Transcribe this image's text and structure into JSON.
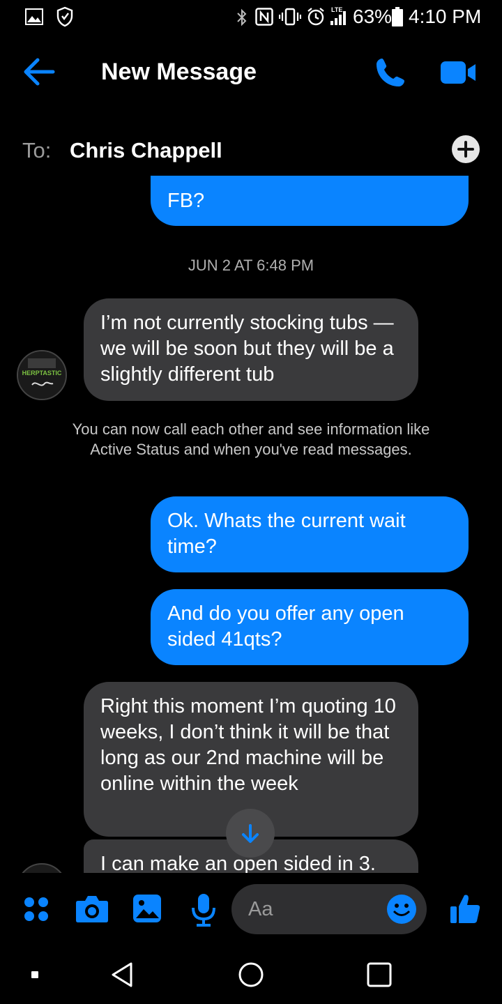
{
  "status_bar": {
    "battery_percent": "63%",
    "time": "4:10 PM",
    "network_label": "LTE"
  },
  "header": {
    "title": "New Message"
  },
  "to_row": {
    "label": "To:",
    "recipient": "Chris Chappell"
  },
  "messages": [
    {
      "type": "outgoing",
      "text": "FB?"
    },
    {
      "type": "timestamp",
      "text": "JUN 2 AT 6:48 PM"
    },
    {
      "type": "incoming",
      "text": "I’m not currently stocking tubs — we will be soon but they will be a slightly different tub"
    },
    {
      "type": "system",
      "text": "You can now call each other and see information like Active Status and when you've read messages."
    },
    {
      "type": "outgoing",
      "text": "Ok. Whats the current wait time?"
    },
    {
      "type": "outgoing",
      "text": "And do you offer any open sided 41qts?"
    },
    {
      "type": "incoming",
      "text": "Right this moment I’m quoting 10 weeks, I don’t think it will be that long as our 2nd machine will be online within the week"
    },
    {
      "type": "incoming",
      "text": "I can make an open sided in 3."
    }
  ],
  "composer": {
    "placeholder": "Aa"
  },
  "avatar": {
    "brand_text": "HERPTASTIC"
  },
  "colors": {
    "accent": "#0a84ff",
    "incoming_bubble": "#3a3a3c",
    "background": "#000000"
  }
}
